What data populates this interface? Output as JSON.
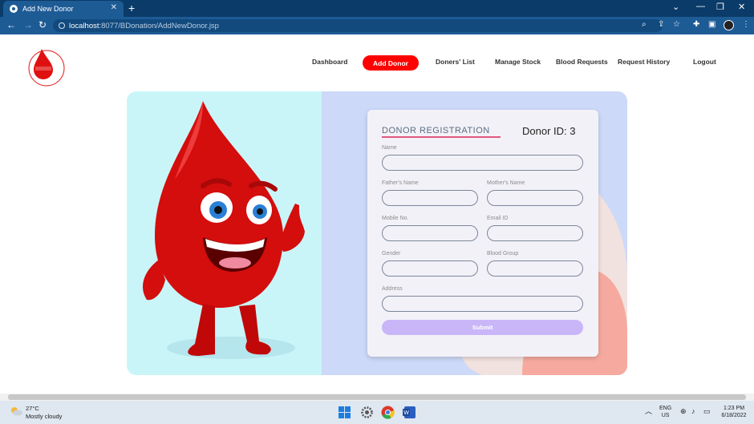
{
  "browser": {
    "tab_title": "Add New Donor",
    "new_tab": "+",
    "url_host": "localhost",
    "url_rest": ":8077/BDonation/AddNewDonor.jsp"
  },
  "nav": {
    "dashboard": "Dashboard",
    "add_donor": "Add Donor",
    "doners_list": "Doners' List",
    "manage_stock": "Manage Stock",
    "blood_requests": "Blood Requests",
    "request_history": "Request History",
    "logout": "Logout"
  },
  "logo": {
    "text": "Blood Donation"
  },
  "form": {
    "title": "DONOR REGISTRATION",
    "donor_id": "Donor ID: 3",
    "fields": {
      "name": {
        "label": "Name",
        "value": ""
      },
      "fathers_name": {
        "label": "Father's Name",
        "value": ""
      },
      "mothers_name": {
        "label": "Mother's Name",
        "value": ""
      },
      "mobile": {
        "label": "Mobile No.",
        "value": ""
      },
      "email": {
        "label": "Email ID",
        "value": ""
      },
      "gender": {
        "label": "Gender",
        "value": ""
      },
      "blood_group": {
        "label": "Blood Group",
        "value": ""
      },
      "address": {
        "label": "Address",
        "value": ""
      }
    },
    "submit_label": "Submit"
  },
  "taskbar": {
    "temperature": "27°C",
    "weather": "Mostly cloudy",
    "lang_top": "ENG",
    "lang_bottom": "US",
    "time": "1:23 PM",
    "date": "6/18/2022"
  },
  "colors": {
    "accent_red": "#ff0000",
    "browser_blue": "#1d5b95",
    "card_left": "#c9f5f8",
    "card_right": "#cdd9f8",
    "submit": "#c9b6f8"
  }
}
